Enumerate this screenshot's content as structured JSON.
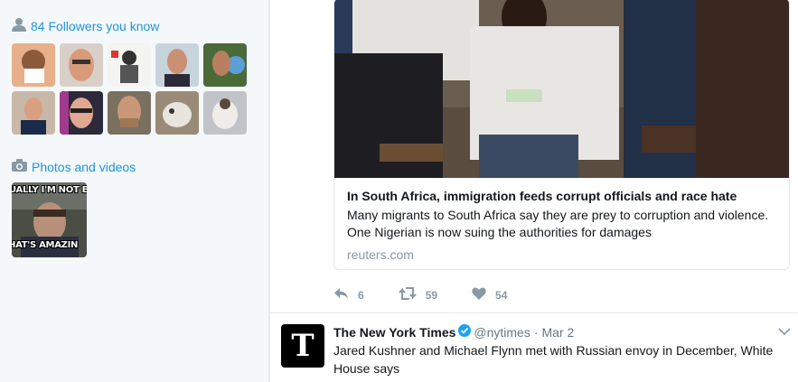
{
  "sidebar": {
    "followers_label": "84 Followers you know",
    "photos_label": "Photos and videos",
    "photo_top_text": "UALLY I'M NOT EVEN",
    "photo_bottom_text": "HAT'S AMAZIN"
  },
  "card": {
    "title": "In South Africa, immigration feeds corrupt officials and race hate",
    "description": "Many migrants to South Africa say they are prey to corruption and violence. One Nigerian is now suing the authorities for damages",
    "domain": "reuters.com"
  },
  "actions": {
    "reply_count": "6",
    "retweet_count": "59",
    "like_count": "54"
  },
  "tweet": {
    "avatar_glyph": "T",
    "name": "The New York Times",
    "handle": "@nytimes",
    "separator": "·",
    "date": "Mar 2",
    "text": "Jared Kushner and Michael Flynn met with Russian envoy in December, White House says"
  },
  "colors": {
    "link": "#1b95e0",
    "muted": "#8899a6",
    "verified": "#1da1f2"
  },
  "icons": [
    "user-icon",
    "camera-icon",
    "reply-icon",
    "retweet-icon",
    "heart-icon",
    "verified-icon",
    "chevron-down-icon"
  ]
}
